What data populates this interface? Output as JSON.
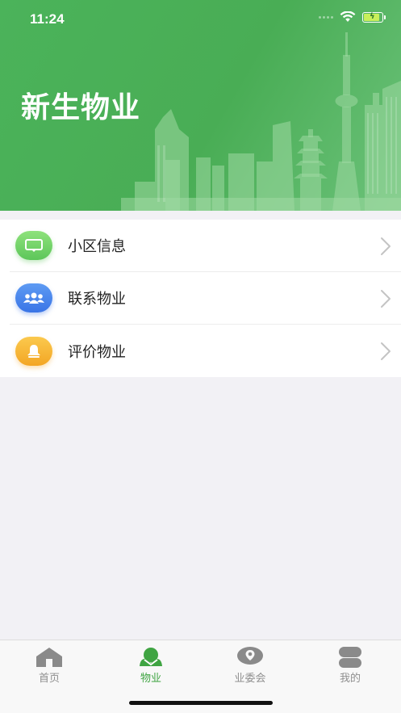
{
  "status_bar": {
    "time": "11:24",
    "battery_color": "#c8ef5a"
  },
  "header": {
    "title": "新生物业",
    "background_color": "#4bb35a"
  },
  "menu": {
    "items": [
      {
        "label": "小区信息",
        "icon": "message-icon",
        "icon_color": "#6dd463"
      },
      {
        "label": "联系物业",
        "icon": "group-icon",
        "icon_color": "#4a86ec"
      },
      {
        "label": "评价物业",
        "icon": "bell-icon",
        "icon_color": "#f6b535"
      }
    ]
  },
  "tabbar": {
    "active_color": "#3fa442",
    "inactive_color": "#8f8f8f",
    "tabs": [
      {
        "label": "首页",
        "icon": "home-icon",
        "active": false
      },
      {
        "label": "物业",
        "icon": "property-icon",
        "active": true
      },
      {
        "label": "业委会",
        "icon": "location-icon",
        "active": false
      },
      {
        "label": "我的",
        "icon": "profile-icon",
        "active": false
      }
    ]
  }
}
